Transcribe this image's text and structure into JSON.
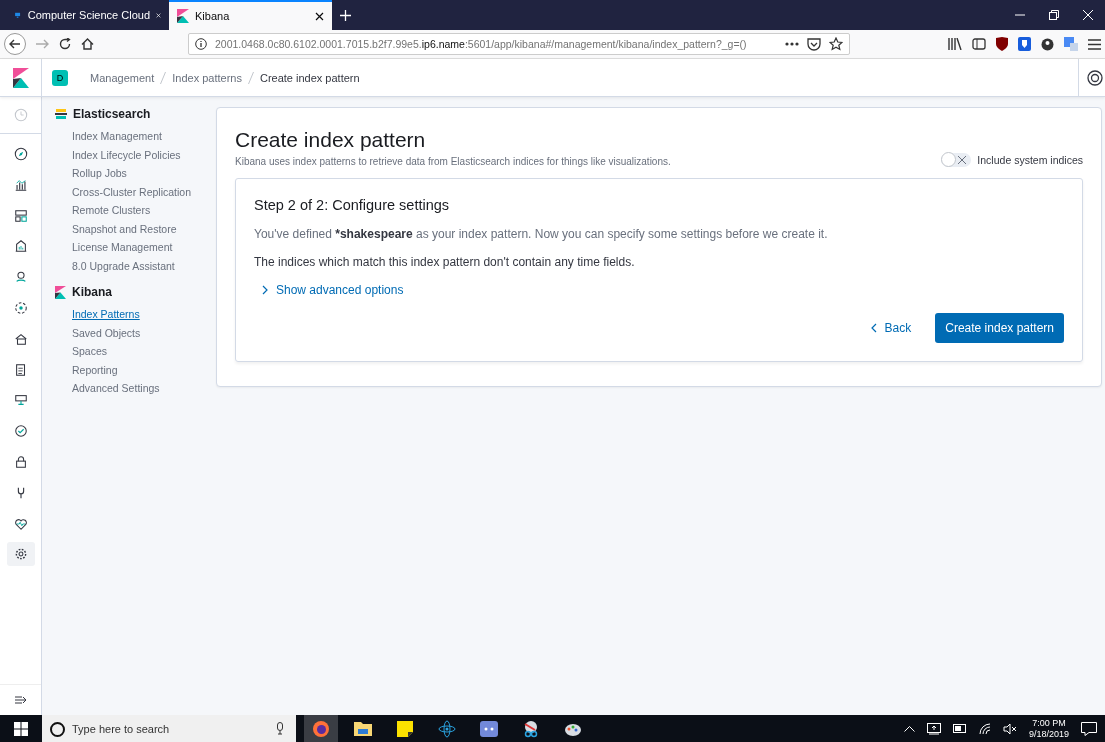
{
  "browser": {
    "tabs": [
      {
        "title": "Computer Science Cloud",
        "selected": false
      },
      {
        "title": "Kibana",
        "selected": true
      }
    ],
    "url": "2001.0468.0c80.6102.0001.7015.b2f7.99e5.**ip6.name**:5601/app/kibana#/management/kibana/index_pattern?_g=()"
  },
  "header": {
    "avatar": "D",
    "breadcrumbs": [
      {
        "label": "Management",
        "current": false
      },
      {
        "label": "Index patterns",
        "current": false
      },
      {
        "label": "Create index pattern",
        "current": true
      }
    ]
  },
  "nav": [
    {
      "selected": false
    },
    {
      "selected": false
    },
    {
      "selected": false
    },
    {
      "selected": false
    },
    {
      "selected": false
    },
    {
      "selected": false
    },
    {
      "selected": false
    },
    {
      "selected": false
    },
    {
      "selected": false
    },
    {
      "selected": false
    },
    {
      "selected": false
    },
    {
      "selected": false
    },
    {
      "selected": false
    },
    {
      "selected": true
    }
  ],
  "sidebar": {
    "groups": [
      {
        "kind": "elasticsearch",
        "title": "Elasticsearch",
        "items": [
          {
            "label": "Index Management",
            "selected": false
          },
          {
            "label": "Index Lifecycle Policies",
            "selected": false
          },
          {
            "label": "Rollup Jobs",
            "selected": false
          },
          {
            "label": "Cross-Cluster Replication",
            "selected": false
          },
          {
            "label": "Remote Clusters",
            "selected": false
          },
          {
            "label": "Snapshot and Restore",
            "selected": false
          },
          {
            "label": "License Management",
            "selected": false
          },
          {
            "label": "8.0 Upgrade Assistant",
            "selected": false
          }
        ]
      },
      {
        "kind": "kibana",
        "title": "Kibana",
        "items": [
          {
            "label": "Index Patterns",
            "selected": true
          },
          {
            "label": "Saved Objects",
            "selected": false
          },
          {
            "label": "Spaces",
            "selected": false
          },
          {
            "label": "Reporting",
            "selected": false
          },
          {
            "label": "Advanced Settings",
            "selected": false
          }
        ]
      }
    ]
  },
  "page": {
    "title": "Create index pattern",
    "subtitle": "Kibana uses index patterns to retrieve data from Elasticsearch indices for things like visualizations.",
    "toggle": {
      "label": "Include system indices",
      "on": false
    },
    "step": {
      "title": "Step 2 of 2: Configure settings",
      "description": "You've defined ***shakespeare** as your index pattern. Now you can specify some settings before we create it.",
      "note": "The indices which match this index pattern don't contain any time fields.",
      "advanced": "Show advanced options",
      "back": "Back",
      "create": "Create index pattern"
    }
  },
  "taskbar": {
    "search_placeholder": "Type here to search",
    "time": "7:00 PM",
    "date": "9/18/2019"
  }
}
